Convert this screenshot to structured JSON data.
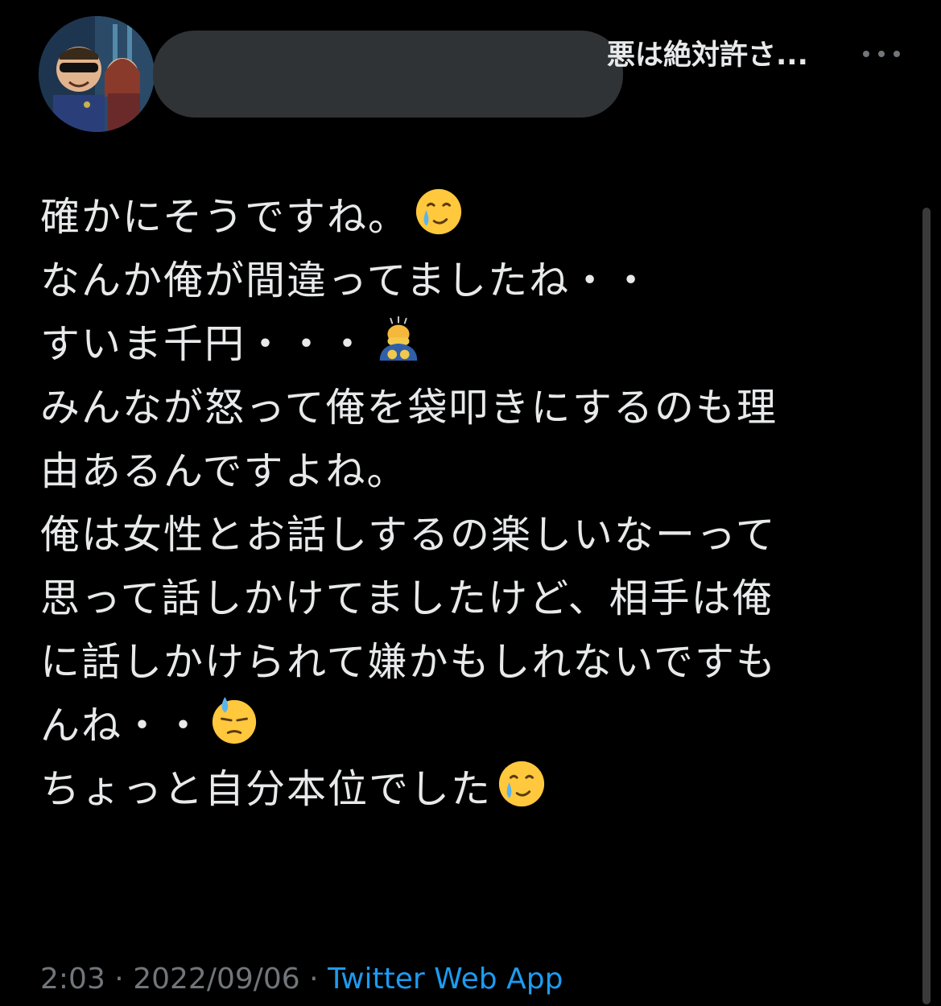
{
  "tweet": {
    "display_name_visible": "悪は絶対許さ...",
    "text_lines": [
      "確かにそうですね。",
      "なんか俺が間違ってましたね・・",
      "すいま千円・・・",
      "みんなが怒って俺を袋叩きにするのも理",
      "由あるんですよね。",
      "俺は女性とお話しするの楽しいなーって",
      "思って話しかけてましたけど、相手は俺",
      "に話しかけられて嫌かもしれないですも",
      "んね・・",
      "ちょっと自分本位でした"
    ],
    "emojis": {
      "line_0": "smiling-face-with-tear-icon",
      "line_2": "person-bowing-icon",
      "line_8": "downcast-face-with-sweat-icon",
      "line_9": "smiling-face-with-tear-icon"
    },
    "time": "2:03",
    "separator": "·",
    "date": "2022/09/06",
    "source": "Twitter Web App"
  },
  "colors": {
    "background": "#000000",
    "text": "#e7e9ea",
    "muted": "#71767b",
    "link": "#1d9bf0",
    "redaction": "#2f3336"
  }
}
